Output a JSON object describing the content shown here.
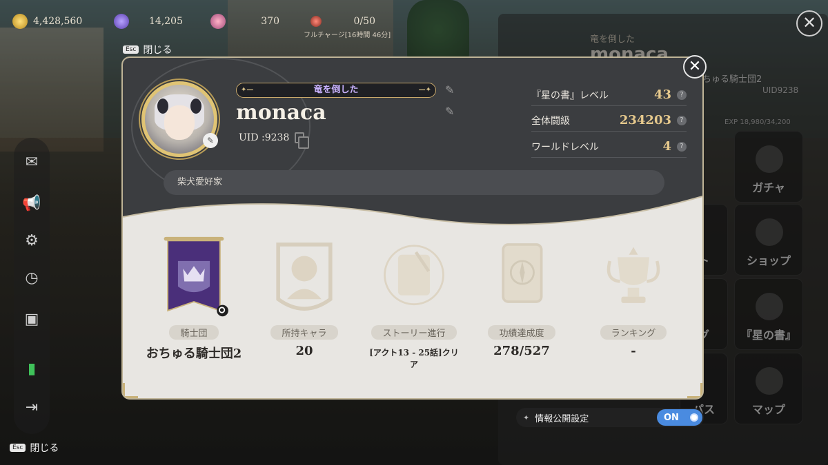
{
  "resources": {
    "gold": "4,428,560",
    "gems": "14,205",
    "coins": "370",
    "stamina": "0/50",
    "stamina_note": "フルチャージ[16時間 46分]"
  },
  "esc_close": {
    "key": "Esc",
    "label": "閉じる"
  },
  "profile": {
    "title": "竜を倒した",
    "name": "monaca",
    "uid": "UID :9238",
    "bio": "柴犬愛好家",
    "stats": [
      {
        "label": "『星の書』レベル",
        "value": "43"
      },
      {
        "label": "全体闘級",
        "value": "234203"
      },
      {
        "label": "ワールドレベル",
        "value": "4"
      }
    ],
    "items": [
      {
        "label": "騎士団",
        "value": "おちゅる騎士団2"
      },
      {
        "label": "所持キャラ",
        "value": "20"
      },
      {
        "label": "ストーリー進行",
        "value": "[アクト13 - 25話]クリア"
      },
      {
        "label": "功績達成度",
        "value": "278/527"
      },
      {
        "label": "ランキング",
        "value": "-"
      }
    ]
  },
  "right_panel": {
    "title": "竜を倒した",
    "name": "monaca",
    "team": "ちゅる騎士団2",
    "uid": "UID9238",
    "exp": "EXP 18,980/34,200",
    "tiles": [
      "ガチャ",
      "ショップ",
      "『星の書』",
      "マップ"
    ],
    "partial_tiles": [
      "ト",
      "グ",
      "パス"
    ]
  },
  "privacy": {
    "label": "情報公開設定",
    "state": "ON"
  },
  "colors": {
    "accent_gold": "#e6c98d",
    "title_purple": "#c9b2ff",
    "toggle_blue": "#4a8be0"
  }
}
